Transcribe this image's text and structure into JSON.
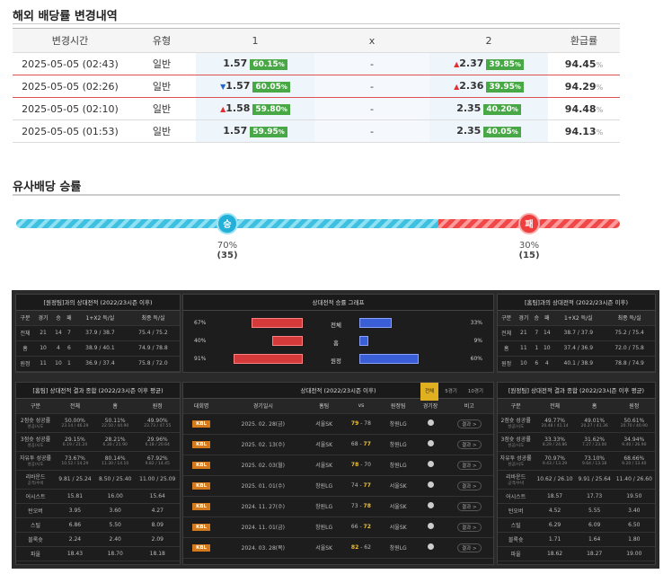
{
  "odds_section": {
    "title": "해외 배당률 변경내역",
    "headers": [
      "변경시간",
      "유형",
      "1",
      "x",
      "2",
      "환급률"
    ],
    "rows": [
      {
        "time": "2025-05-05 (02:43)",
        "type": "일반",
        "v1": "1.57",
        "p1": "60.15",
        "a1": "",
        "x": "-",
        "v2": "2.37",
        "p2": "39.85",
        "a2": "up",
        "ref": "94.45"
      },
      {
        "time": "2025-05-05 (02:26)",
        "type": "일반",
        "v1": "1.57",
        "p1": "60.05",
        "a1": "down",
        "x": "-",
        "v2": "2.36",
        "p2": "39.95",
        "a2": "up",
        "ref": "94.29"
      },
      {
        "time": "2025-05-05 (02:10)",
        "type": "일반",
        "v1": "1.58",
        "p1": "59.80",
        "a1": "up",
        "x": "-",
        "v2": "2.35",
        "p2": "40.20",
        "a2": "",
        "ref": "94.48"
      },
      {
        "time": "2025-05-05 (01:53)",
        "type": "일반",
        "v1": "1.57",
        "p1": "59.95",
        "a1": "",
        "x": "-",
        "v2": "2.35",
        "p2": "40.05",
        "a2": "",
        "ref": "94.13"
      }
    ],
    "pct_unit": "%",
    "colors": {
      "pct_badge": "#48a845",
      "up": "#e03030",
      "down": "#2266cc"
    }
  },
  "similar_section": {
    "title": "유사배당 승률",
    "win": {
      "label": "승",
      "pct": "70%",
      "count": "(35)",
      "fraction": 0.7
    },
    "loss": {
      "label": "패",
      "pct": "30%",
      "count": "(15)",
      "fraction": 0.3
    }
  },
  "stats": {
    "home_panel": {
      "title": "[원정팀]과의 상대전적 (2022/23시즌 이후)",
      "headers": [
        "구분",
        "경기",
        "승",
        "패",
        "1+X2 득/실",
        "최종 득/실"
      ],
      "rows": [
        [
          "전체",
          "21",
          "14",
          "7",
          "37.9 / 38.7",
          "75.4 / 75.2"
        ],
        [
          "홈",
          "10",
          "4",
          "6",
          "38.9 / 40.1",
          "74.9 / 78.8"
        ],
        [
          "원정",
          "11",
          "10",
          "1",
          "36.9 / 37.4",
          "75.8 / 72.0"
        ]
      ]
    },
    "graph_panel": {
      "title": "상대전적 승률 그래프",
      "rows": [
        {
          "label": "전체",
          "left": "67%",
          "right": "33%",
          "lf": 0.67,
          "rf": 0.33
        },
        {
          "label": "홈",
          "left": "40%",
          "right": "9%",
          "lf": 0.4,
          "rf": 0.09
        },
        {
          "label": "원정",
          "left": "91%",
          "right": "60%",
          "lf": 0.91,
          "rf": 0.6
        }
      ]
    },
    "away_panel": {
      "title": "[홈팀]과의 상대전적 (2022/23시즌 이후)",
      "headers": [
        "구분",
        "경기",
        "승",
        "패",
        "1+X2 득/실",
        "최종 득/실"
      ],
      "rows": [
        [
          "전체",
          "21",
          "7",
          "14",
          "38.7 / 37.9",
          "75.2 / 75.4"
        ],
        [
          "홈",
          "11",
          "1",
          "10",
          "37.4 / 36.9",
          "72.0 / 75.8"
        ],
        [
          "원정",
          "10",
          "6",
          "4",
          "40.1 / 38.9",
          "78.8 / 74.9"
        ]
      ]
    },
    "home_summary": {
      "title": "[홈팀] 상대전적 결과 종합 (2022/23시즌 이후 평균)",
      "headers": [
        "구분",
        "전체",
        "홈",
        "원정"
      ],
      "rows": [
        {
          "k": "2점슛 성공률",
          "sub": "성공/시도",
          "a": "50.00%",
          "as": "23.14 / 46.29",
          "b": "50.11%",
          "bs": "22.50 / 44.90",
          "c": "49.90%",
          "cs": "23.73 / 47.55"
        },
        {
          "k": "3점슛 성공률",
          "sub": "성공/시도",
          "a": "29.15%",
          "as": "6.19 / 21.24",
          "b": "28.21%",
          "bs": "6.30 / 21.90",
          "c": "29.96%",
          "cs": "6.18 / 20.64"
        },
        {
          "k": "자유투 성공률",
          "sub": "성공/시도",
          "a": "73.67%",
          "as": "10.52 / 14.29",
          "b": "80.14%",
          "bs": "11.30 / 14.10",
          "c": "67.92%",
          "cs": "9.82 / 14.45"
        },
        {
          "k": "리바운드",
          "sub": "공격/수비",
          "a": "9.81 / 25.24",
          "as": "",
          "b": "8.50 / 25.40",
          "bs": "",
          "c": "11.00 / 25.09",
          "cs": ""
        },
        {
          "k": "어시스트",
          "sub": "",
          "a": "15.81",
          "as": "",
          "b": "16.00",
          "bs": "",
          "c": "15.64",
          "cs": ""
        },
        {
          "k": "턴오버",
          "sub": "",
          "a": "3.95",
          "as": "",
          "b": "3.60",
          "bs": "",
          "c": "4.27",
          "cs": ""
        },
        {
          "k": "스틸",
          "sub": "",
          "a": "6.86",
          "as": "",
          "b": "5.50",
          "bs": "",
          "c": "8.09",
          "cs": ""
        },
        {
          "k": "블록슛",
          "sub": "",
          "a": "2.24",
          "as": "",
          "b": "2.40",
          "bs": "",
          "c": "2.09",
          "cs": ""
        },
        {
          "k": "파울",
          "sub": "",
          "a": "18.43",
          "as": "",
          "b": "18.70",
          "bs": "",
          "c": "18.18",
          "cs": ""
        }
      ]
    },
    "matches": {
      "title": "상대전적 (2022/23시즌 이후)",
      "tabs": [
        "전체",
        "5경기",
        "10경기"
      ],
      "headers": [
        "대회명",
        "경기일시",
        "홈팀",
        "vs",
        "원정팀",
        "경기장",
        "비고"
      ],
      "rows": [
        {
          "league": "KBL",
          "date": "2025. 02. 28(금)",
          "home": "서울SK",
          "hs": "79",
          "as": "78",
          "away": "창원LG",
          "win": "home",
          "note": "결과 >"
        },
        {
          "league": "KBL",
          "date": "2025. 02. 13(수)",
          "home": "서울SK",
          "hs": "68",
          "as": "77",
          "away": "창원LG",
          "win": "away",
          "note": "결과 >"
        },
        {
          "league": "KBL",
          "date": "2025. 02. 03(월)",
          "home": "서울SK",
          "hs": "78",
          "as": "70",
          "away": "창원LG",
          "win": "home",
          "note": "결과 >"
        },
        {
          "league": "KBL",
          "date": "2025. 01. 01(수)",
          "home": "창원LG",
          "hs": "74",
          "as": "77",
          "away": "서울SK",
          "win": "away",
          "note": "결과 >"
        },
        {
          "league": "KBL",
          "date": "2024. 11. 27(수)",
          "home": "창원LG",
          "hs": "73",
          "as": "78",
          "away": "서울SK",
          "win": "away",
          "note": "결과 >"
        },
        {
          "league": "KBL",
          "date": "2024. 11. 01(금)",
          "home": "창원LG",
          "hs": "66",
          "as": "72",
          "away": "서울SK",
          "win": "away",
          "note": "결과 >"
        },
        {
          "league": "KBL",
          "date": "2024. 03. 28(목)",
          "home": "서울SK",
          "hs": "82",
          "as": "62",
          "away": "창원LG",
          "win": "home",
          "note": "결과 >"
        }
      ]
    },
    "away_summary": {
      "title": "[원정팀] 상대전적 결과 종합 (2022/23시즌 이후 평균)",
      "headers": [
        "구분",
        "전체",
        "홈",
        "원정"
      ],
      "rows": [
        {
          "k": "2점슛 성공률",
          "sub": "성공/시도",
          "a": "49.77%",
          "as": "20.48 / 41.14",
          "b": "49.01%",
          "bs": "20.27 / 41.36",
          "c": "50.61%",
          "cs": "20.70 / 40.90"
        },
        {
          "k": "3점슛 성공률",
          "sub": "성공/시도",
          "a": "33.33%",
          "as": "8.29 / 24.86",
          "b": "31.62%",
          "bs": "7.27 / 23.00",
          "c": "34.94%",
          "cs": "9.40 / 26.90"
        },
        {
          "k": "자유투 성공률",
          "sub": "성공/시도",
          "a": "70.97%",
          "as": "9.43 / 13.29",
          "b": "73.10%",
          "bs": "9.64 / 13.18",
          "c": "68.66%",
          "cs": "9.20 / 13.40"
        },
        {
          "k": "리바운드",
          "sub": "공격/수비",
          "a": "10.62 / 26.10",
          "as": "",
          "b": "9.91 / 25.64",
          "bs": "",
          "c": "11.40 / 26.60",
          "cs": ""
        },
        {
          "k": "어시스트",
          "sub": "",
          "a": "18.57",
          "as": "",
          "b": "17.73",
          "bs": "",
          "c": "19.50",
          "cs": ""
        },
        {
          "k": "턴오버",
          "sub": "",
          "a": "4.52",
          "as": "",
          "b": "5.55",
          "bs": "",
          "c": "3.40",
          "cs": ""
        },
        {
          "k": "스틸",
          "sub": "",
          "a": "6.29",
          "as": "",
          "b": "6.09",
          "bs": "",
          "c": "6.50",
          "cs": ""
        },
        {
          "k": "블록슛",
          "sub": "",
          "a": "1.71",
          "as": "",
          "b": "1.64",
          "bs": "",
          "c": "1.80",
          "cs": ""
        },
        {
          "k": "파울",
          "sub": "",
          "a": "18.62",
          "as": "",
          "b": "18.27",
          "bs": "",
          "c": "19.00",
          "cs": ""
        }
      ]
    }
  }
}
